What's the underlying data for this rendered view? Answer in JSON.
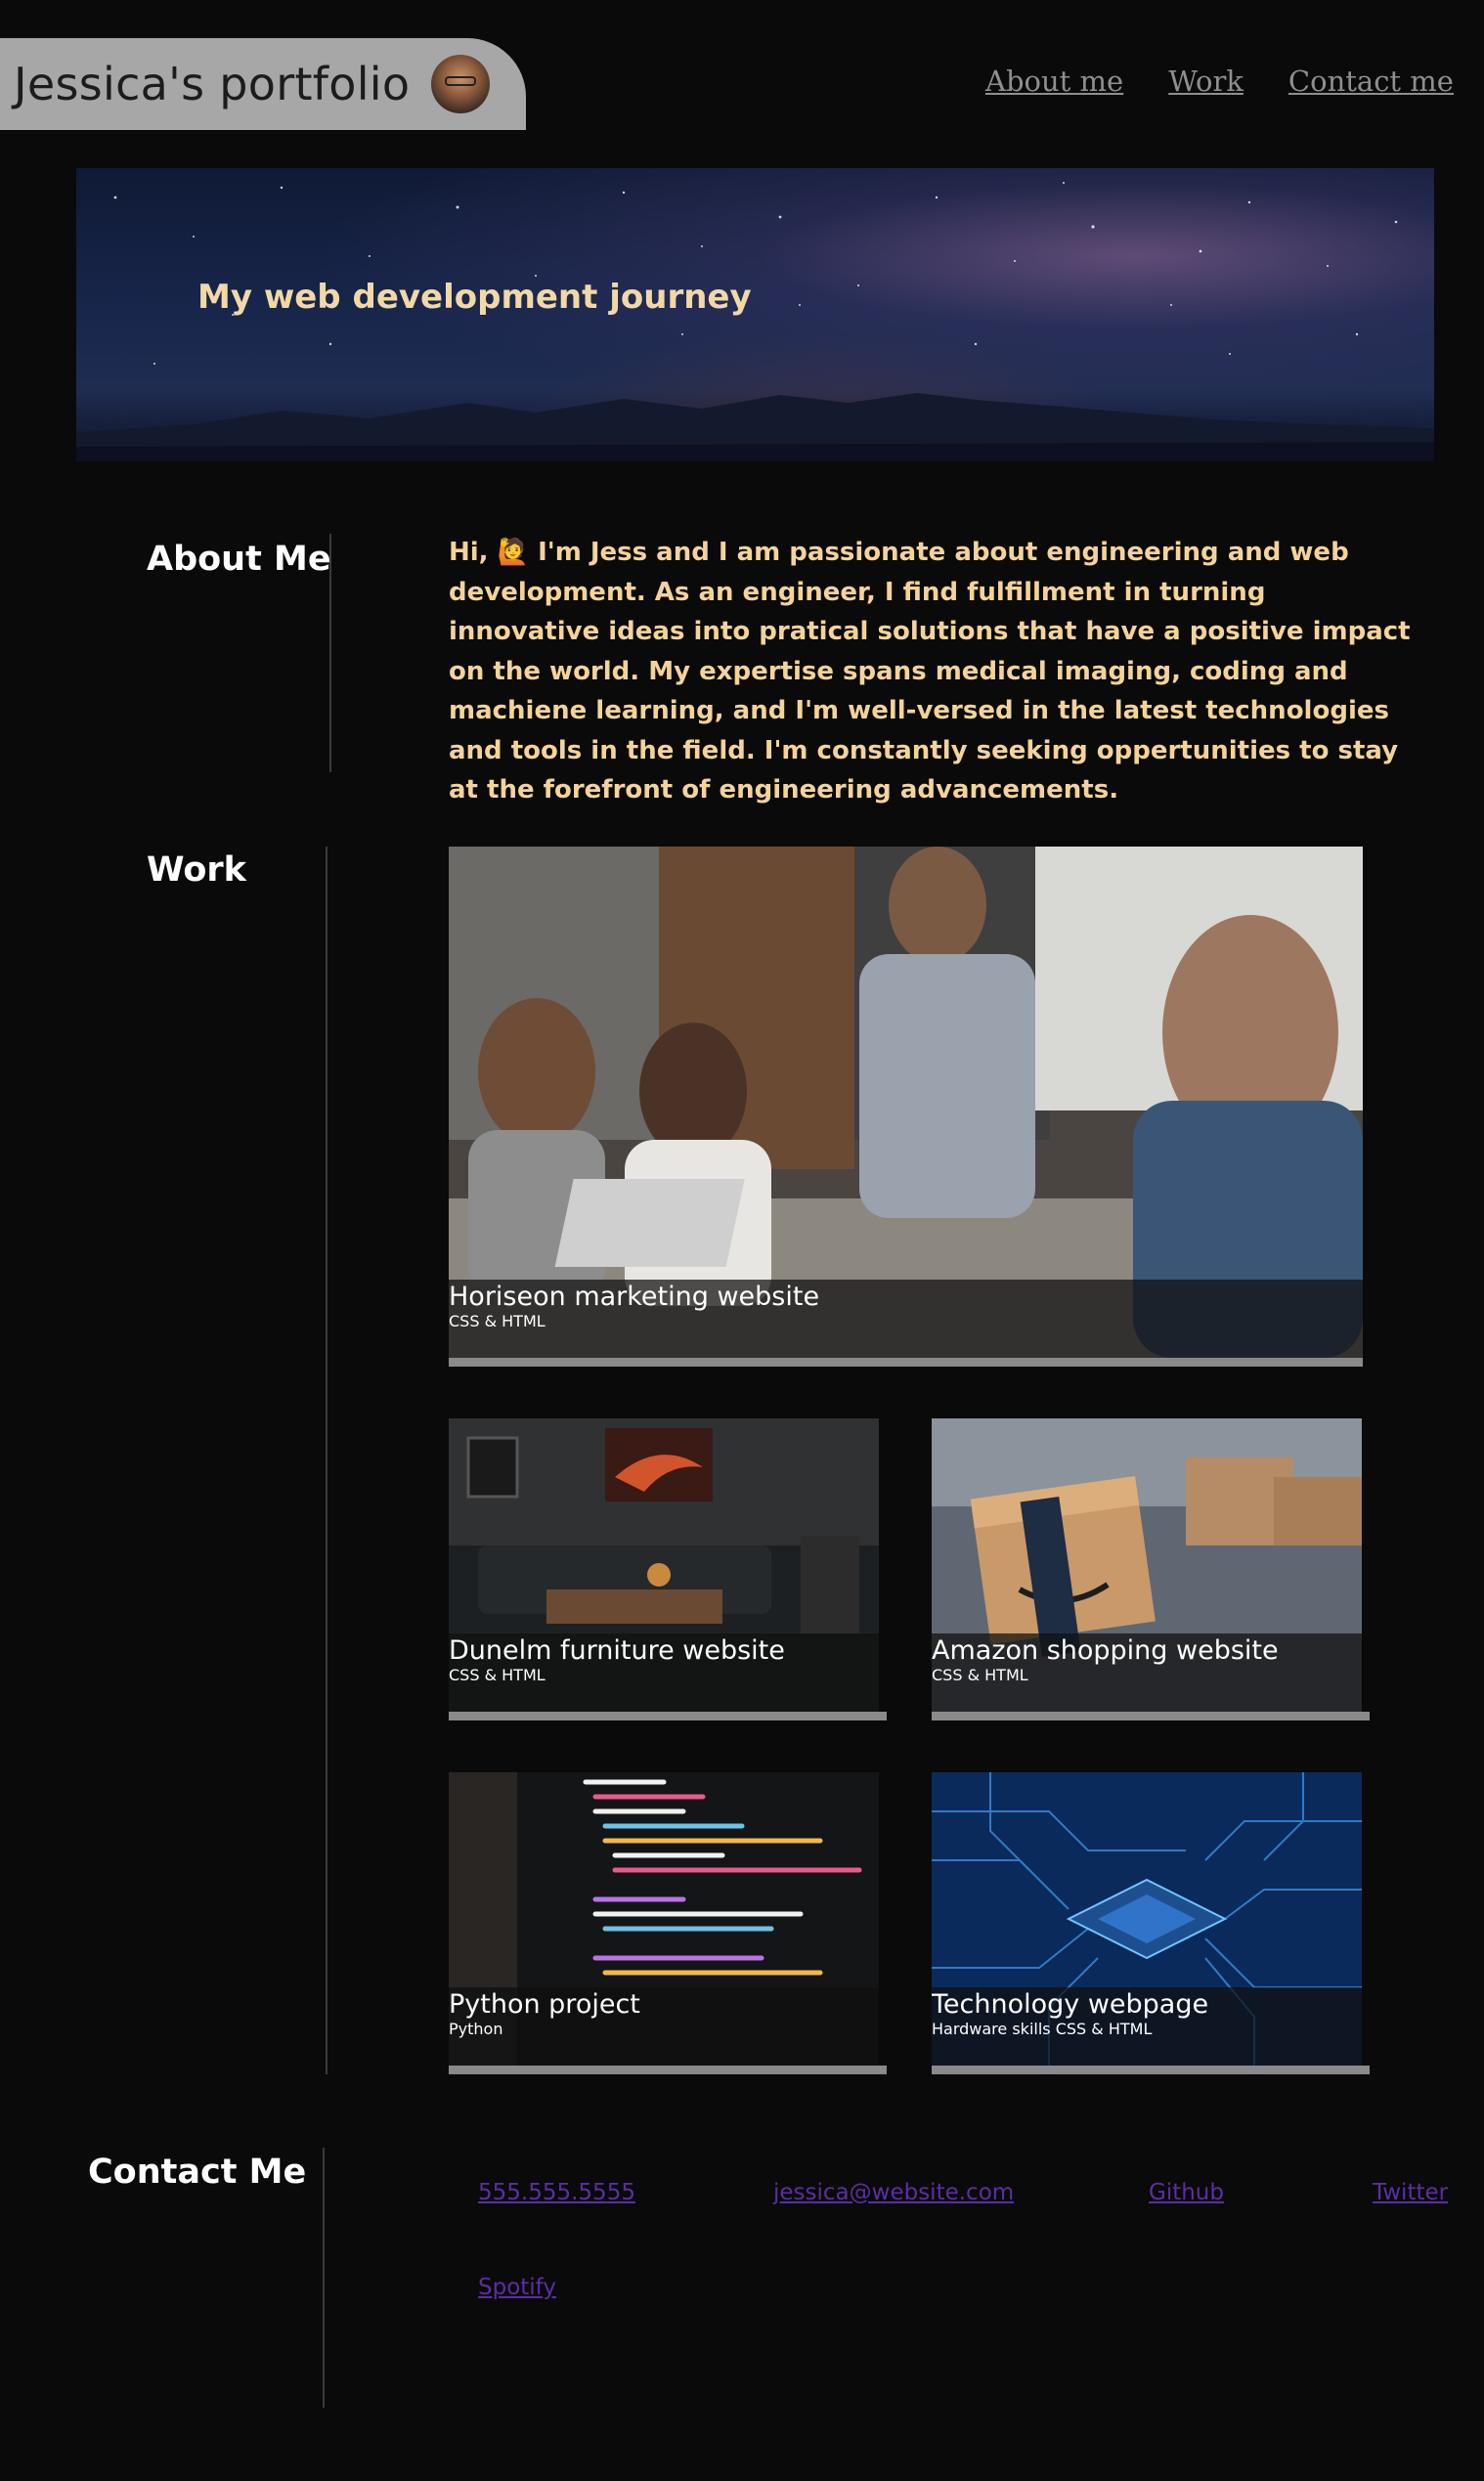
{
  "header": {
    "brand": "Jessica's portfolio",
    "nav": [
      "About me",
      "Work",
      "Contact me"
    ]
  },
  "hero": {
    "title": "My web development journey"
  },
  "about": {
    "heading": "About Me",
    "wave": "🙋",
    "intro": "Hi,",
    "body": "I'm Jess and I am passionate about engineering and web development. As an engineer, I find fulfillment in turning innovative ideas into pratical solutions that have a positive impact on the world. My expertise spans medical imaging, coding and machiene learning, and I'm well-versed in the latest technologies and tools in the field. I'm constantly seeking oppertunities to stay at the forefront of engineering advancements."
  },
  "work": {
    "heading": "Work",
    "projects": [
      {
        "title": "Horiseon marketing website",
        "subtitle": "CSS & HTML",
        "icon": "team-meeting-photo"
      },
      {
        "title": "Dunelm furniture website",
        "subtitle": "CSS & HTML",
        "icon": "living-room-photo"
      },
      {
        "title": "Amazon shopping website",
        "subtitle": "CSS & HTML",
        "icon": "amazon-boxes-photo"
      },
      {
        "title": "Python project",
        "subtitle": "Python",
        "icon": "code-screen-photo"
      },
      {
        "title": "Technology webpage",
        "subtitle": "Hardware skills CSS & HTML",
        "icon": "circuit-board-photo"
      }
    ]
  },
  "contact": {
    "heading": "Contact Me",
    "links": [
      "555.555.5555",
      "jessica@website.com",
      "Github",
      "Twitter",
      "Spotify"
    ]
  },
  "colors": {
    "background": "#0a0a0a",
    "brand_bg": "#a7a7a7",
    "accent_text": "#f4d39a",
    "link": "#5c2ea3",
    "nav_link": "#8f8f8f"
  }
}
